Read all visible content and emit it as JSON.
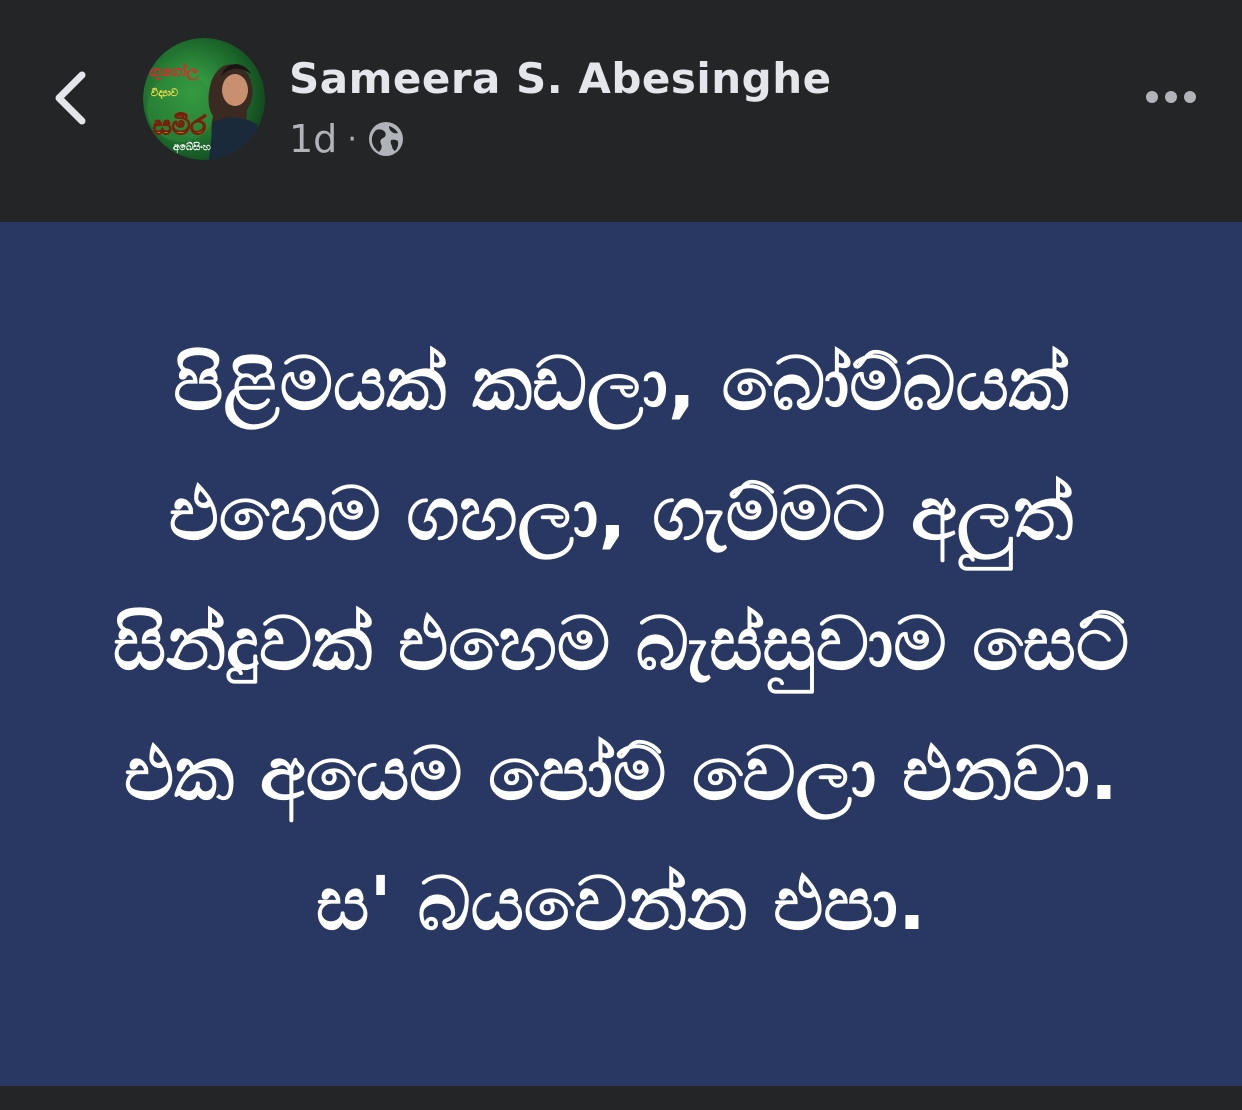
{
  "header": {
    "author_name": "Sameera S. Abesinghe",
    "timestamp": "1d",
    "separator": "·",
    "audience_icon": "globe-icon",
    "back_icon": "chevron-left-icon",
    "more_icon": "more-horizontal-icon"
  },
  "avatar": {
    "badge_text_top": "භූගෝල",
    "badge_text_mid": "විද්‍යාව",
    "badge_name": "සමීර",
    "badge_surname": "අබේසිංහ"
  },
  "post": {
    "text": "පිළිමයක් කඩලා, බෝම්බයක් එහෙම ගහලා, ගැම්මට අලුත් සින්දුවක් එහෙම බැස්සුවාම සෙට් එක අයෙම පෝම් වෙලා එනවා. ස' බයවෙන්න එපා.",
    "background_color": "#283862",
    "text_color": "#ffffff"
  },
  "colors": {
    "app_bg": "#242526",
    "primary_text": "#e4e6eb",
    "secondary_text": "#b0b3b8"
  }
}
